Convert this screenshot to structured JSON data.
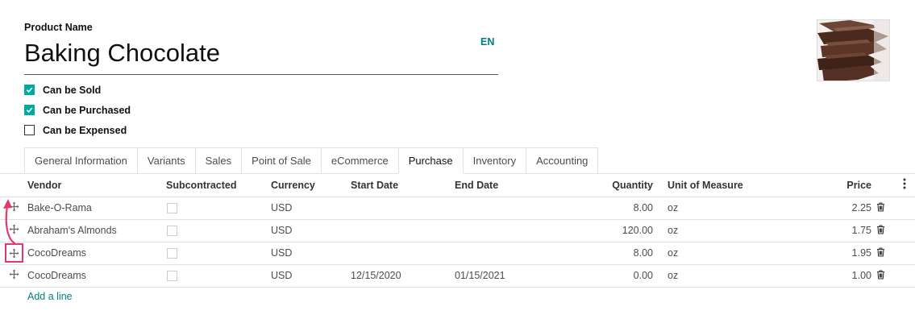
{
  "product": {
    "field_label": "Product Name",
    "name": "Baking Chocolate",
    "language": "EN"
  },
  "options": [
    {
      "label": "Can be Sold",
      "checked": true
    },
    {
      "label": "Can be Purchased",
      "checked": true
    },
    {
      "label": "Can be Expensed",
      "checked": false
    }
  ],
  "tabs": [
    {
      "label": "General Information",
      "active": false
    },
    {
      "label": "Variants",
      "active": false
    },
    {
      "label": "Sales",
      "active": false
    },
    {
      "label": "Point of Sale",
      "active": false
    },
    {
      "label": "eCommerce",
      "active": false
    },
    {
      "label": "Purchase",
      "active": true
    },
    {
      "label": "Inventory",
      "active": false
    },
    {
      "label": "Accounting",
      "active": false
    }
  ],
  "table": {
    "columns": {
      "vendor": "Vendor",
      "subcontracted": "Subcontracted",
      "currency": "Currency",
      "start_date": "Start Date",
      "end_date": "End Date",
      "quantity": "Quantity",
      "uom": "Unit of Measure",
      "price": "Price"
    },
    "rows": [
      {
        "vendor": "Bake-O-Rama",
        "subcontracted": false,
        "currency": "USD",
        "start_date": "",
        "end_date": "",
        "quantity": "8.00",
        "uom": "oz",
        "price": "2.25"
      },
      {
        "vendor": "Abraham's Almonds",
        "subcontracted": false,
        "currency": "USD",
        "start_date": "",
        "end_date": "",
        "quantity": "120.00",
        "uom": "oz",
        "price": "1.75"
      },
      {
        "vendor": "CocoDreams",
        "subcontracted": false,
        "currency": "USD",
        "start_date": "",
        "end_date": "",
        "quantity": "8.00",
        "uom": "oz",
        "price": "1.95"
      },
      {
        "vendor": "CocoDreams",
        "subcontracted": false,
        "currency": "USD",
        "start_date": "12/15/2020",
        "end_date": "01/15/2021",
        "quantity": "0.00",
        "uom": "oz",
        "price": "1.00"
      }
    ],
    "add_line_label": "Add a line"
  },
  "colors": {
    "accent": "#017e84",
    "checkbox": "#01a9a1",
    "highlight": "#e23b6a"
  },
  "icons": {
    "drag_handle": "move-arrows-icon",
    "delete": "trash-icon",
    "column_options": "vertical-dots-icon"
  }
}
